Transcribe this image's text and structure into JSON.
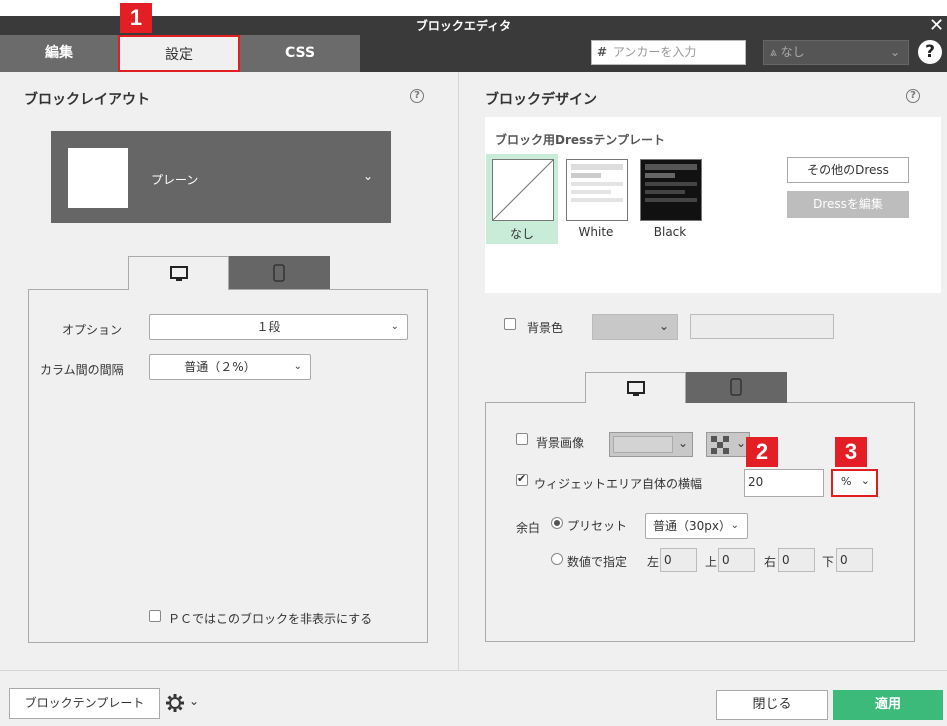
{
  "window": {
    "title": "ブロックエディタ"
  },
  "tabs": {
    "edit": "編集",
    "settings": "設定",
    "css": "CSS"
  },
  "header": {
    "anchor_placeholder": "アンカーを入力",
    "anchor_hash": "#",
    "anchor_select_value": "なし",
    "help_glyph": "?"
  },
  "badges": {
    "b1": "1",
    "b2": "2",
    "b3": "3"
  },
  "colors": {
    "accent_green": "#3cba79",
    "badge_red": "#e31e24",
    "titlebar": "#3a3a3a"
  },
  "left": {
    "title": "ブロックレイアウト",
    "layout_value": "プレーン",
    "option_label": "オプション",
    "option_value": "１段",
    "gap_label": "カラム間の間隔",
    "gap_value": "普通（２%）",
    "hide_pc_label": "ＰＣではこのブロックを非表示にする"
  },
  "right": {
    "title": "ブロックデザイン",
    "dress_caption": "ブロック用Dressテンプレート",
    "dress_items": [
      {
        "name": "なし",
        "selected": true
      },
      {
        "name": "White",
        "selected": false
      },
      {
        "name": "Black",
        "selected": false
      }
    ],
    "other_dress_button": "その他のDress",
    "edit_dress_button": "Dressを編集",
    "bg_color_label": "背景色",
    "bg_image_label": "背景画像",
    "widget_width_label": "ウィジェットエリア自体の横幅",
    "widget_width_value": "20",
    "widget_width_unit": "%",
    "widget_width_checked": true,
    "margin_label": "余白",
    "preset_label": "プリセット",
    "preset_value": "普通（30px）",
    "numeric_label": "数値で指定",
    "left_label": "左",
    "left_value": "0",
    "top_label": "上",
    "top_value": "0",
    "right_label": "右",
    "right_value": "0",
    "bottom_label": "下",
    "bottom_value": "0"
  },
  "footer": {
    "template_button": "ブロックテンプレート",
    "close_button": "閉じる",
    "apply_button": "適用"
  }
}
